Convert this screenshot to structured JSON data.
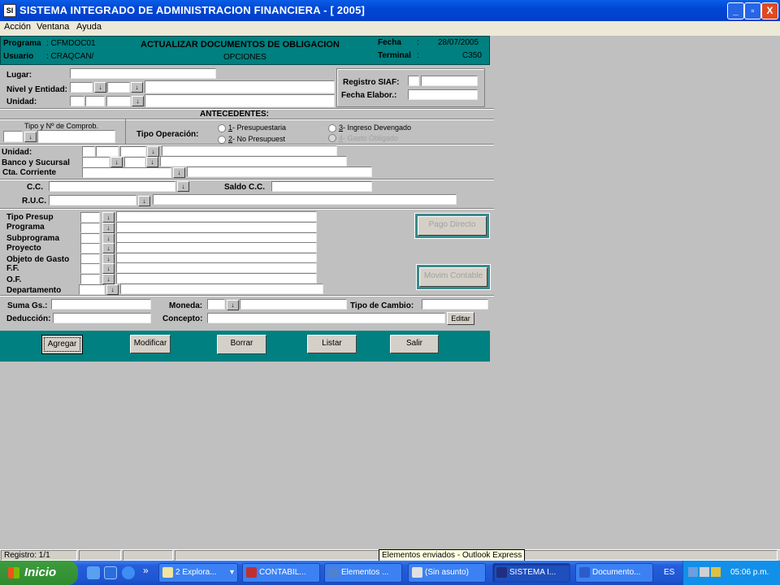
{
  "window": {
    "title": "SISTEMA INTEGRADO DE ADMINISTRACION FINANCIERA - [ 2005]",
    "icon_text": "SI",
    "min": "_",
    "max": "▫",
    "close": "X"
  },
  "menu": [
    "Acción",
    "Ventana",
    "Ayuda"
  ],
  "header": {
    "programa_label": "Programa",
    "programa_value": ": CFMDOC01",
    "usuario_label": "Usuario",
    "usuario_value": ": CRAQCAN/",
    "title": "ACTUALIZAR DOCUMENTOS DE OBLIGACION",
    "subtitle": "OPCIONES",
    "fecha_label": "Fecha",
    "fecha_sep": ":",
    "fecha_value": "28/07/2005",
    "terminal_label": "Terminal",
    "terminal_sep": ":",
    "terminal_value": "C350"
  },
  "labels": {
    "lugar": "Lugar:",
    "nivel": "Nivel y Entidad:",
    "unidad": "Unidad:",
    "registro_siaf": "Registro SIAF:",
    "fecha_elabor": "Fecha Elabor.:",
    "antecedentes": "ANTECEDENTES:",
    "tipo_comprob": "Tipo y Nº de Comprob.",
    "tipo_operacion": "Tipo Operación:",
    "unidad2": "Unidad:",
    "banco": "Banco y Sucursal",
    "cta": "Cta. Corriente",
    "cc": "C.C.",
    "saldo": "Saldo C.C.",
    "ruc": "R.U.C.",
    "tipo_presup": "Tipo Presup",
    "programa": "Programa",
    "subprograma": "Subprograma",
    "proyecto": "Proyecto",
    "objeto": "Objeto de Gasto",
    "ff": "F.F.",
    "of": "O.F.",
    "departamento": "Departamento",
    "suma": "Suma Gs.:",
    "deduccion": "Deducción:",
    "moneda": "Moneda:",
    "concepto": "Concepto:",
    "tipo_cambio": "Tipo de Cambio:"
  },
  "radios": {
    "r1_key": "1",
    "r1_text": "- Presupuestaria",
    "r2_key": "2",
    "r2_text": "- No Presupuest",
    "r3_key": "3",
    "r3_text": "- Ingreso Devengado",
    "r4_key": "4",
    "r4_text": "- Gasto Obligado"
  },
  "buttons": {
    "pago": "Pago Directo",
    "movim": "Movim Contable",
    "editar": "Editar",
    "agregar": "Agregar",
    "modificar": "Modificar",
    "borrar": "Borrar",
    "listar": "Listar",
    "salir": "Salir"
  },
  "status": {
    "registro": "Registro: 1/1",
    "tooltip": "Elementos enviados - Outlook Express"
  },
  "taskbar": {
    "start": "Inicio",
    "chevron": "»",
    "items": [
      "2 Explora...",
      "CONTABIL...",
      "Elementos ...",
      "(Sin asunto)",
      "SISTEMA I...",
      "Documento..."
    ],
    "lang": "ES",
    "clock": "05:06 p.m."
  },
  "icons": {
    "dropdown": "↓",
    "taskbar_arrow": "▾"
  }
}
